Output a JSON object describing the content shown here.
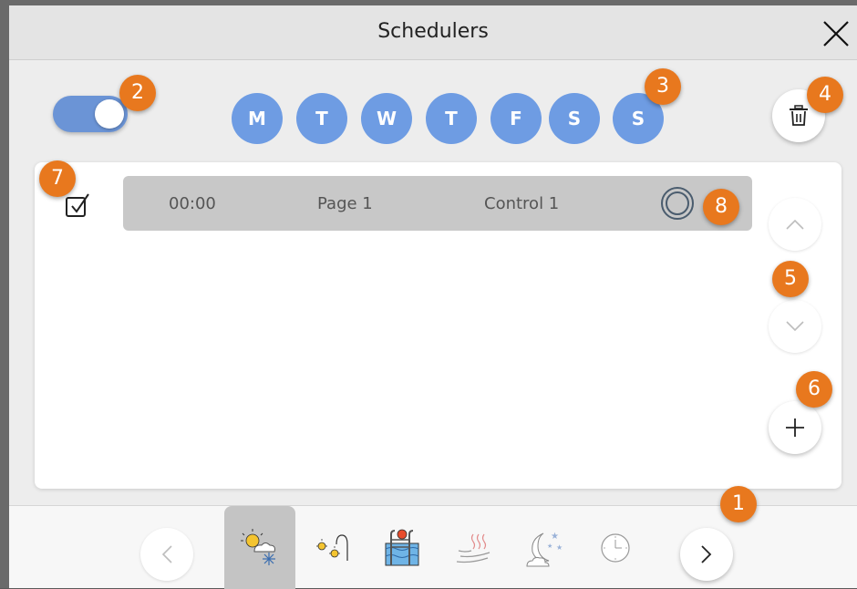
{
  "window": {
    "title": "Schedulers"
  },
  "days": [
    "M",
    "T",
    "W",
    "T",
    "F",
    "S",
    "S"
  ],
  "schedule_row": {
    "time": "00:00",
    "page": "Page 1",
    "control": "Control 1"
  },
  "badges": [
    "1",
    "2",
    "3",
    "4",
    "5",
    "6",
    "7",
    "8"
  ],
  "bottom_tabs": [
    "weather-icon",
    "lights-icon",
    "pool-icon",
    "heating-icon",
    "night-icon",
    "clock-icon"
  ],
  "colors": {
    "accent": "#6e9ce3",
    "toggle": "#6b94d6",
    "badge": "#e8781e",
    "row": "#c8c8c8"
  }
}
